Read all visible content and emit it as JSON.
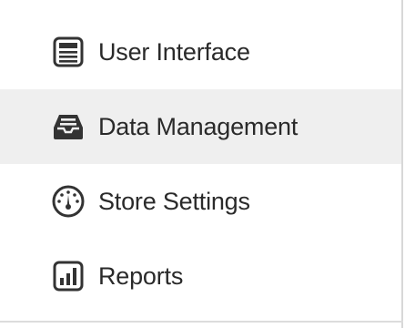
{
  "menu": {
    "items": [
      {
        "label": "User Interface",
        "icon": "user-interface-icon",
        "active": false
      },
      {
        "label": "Data Management",
        "icon": "data-management-icon",
        "active": true
      },
      {
        "label": "Store Settings",
        "icon": "gauge-icon",
        "active": false
      },
      {
        "label": "Reports",
        "icon": "bar-chart-icon",
        "active": false
      }
    ],
    "colors": {
      "active_background": "#efefef",
      "text": "#2a2a2a",
      "icon": "#333333"
    }
  }
}
